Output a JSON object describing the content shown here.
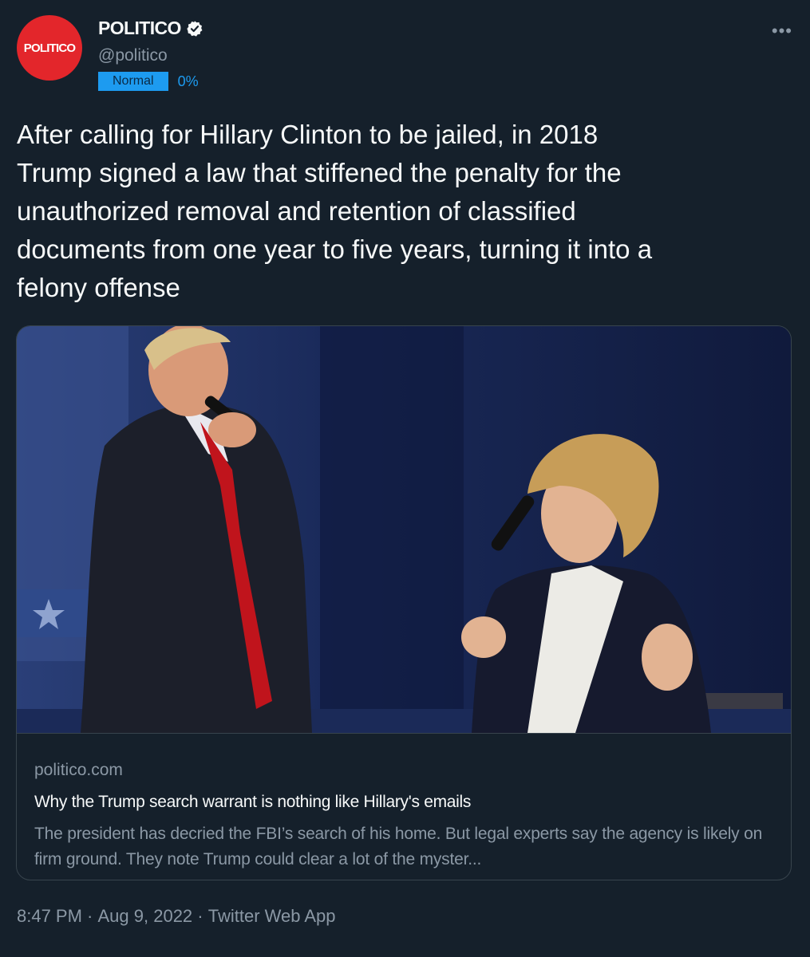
{
  "account": {
    "avatar_text": "POLITICO",
    "display_name": "POLITICO",
    "handle": "@politico",
    "badge_label": "Normal",
    "badge_percent": "0%"
  },
  "tweet": {
    "text": "After calling for Hillary Clinton to be jailed, in 2018\nTrump signed a law that stiffened the penalty for the\nunauthorized removal and retention of classified\ndocuments from one year to five years, turning it into a\nfelony offense"
  },
  "card": {
    "domain": "politico.com",
    "title": "Why the Trump search warrant is nothing like Hillary's emails",
    "description": "The president has decried the FBI’s search of his home. But legal experts say the agency is likely on firm ground. They note Trump could clear a lot of the myster..."
  },
  "meta": {
    "time": "8:47 PM",
    "separator": " · ",
    "date": "Aug 9, 2022",
    "source": "Twitter Web App"
  },
  "icons": {
    "more": "more-options-icon",
    "verified": "verified-badge-icon"
  },
  "colors": {
    "background": "#15202b",
    "accent": "#1d9bf0",
    "avatar": "#e3262b",
    "secondary_text": "#8b98a5"
  }
}
